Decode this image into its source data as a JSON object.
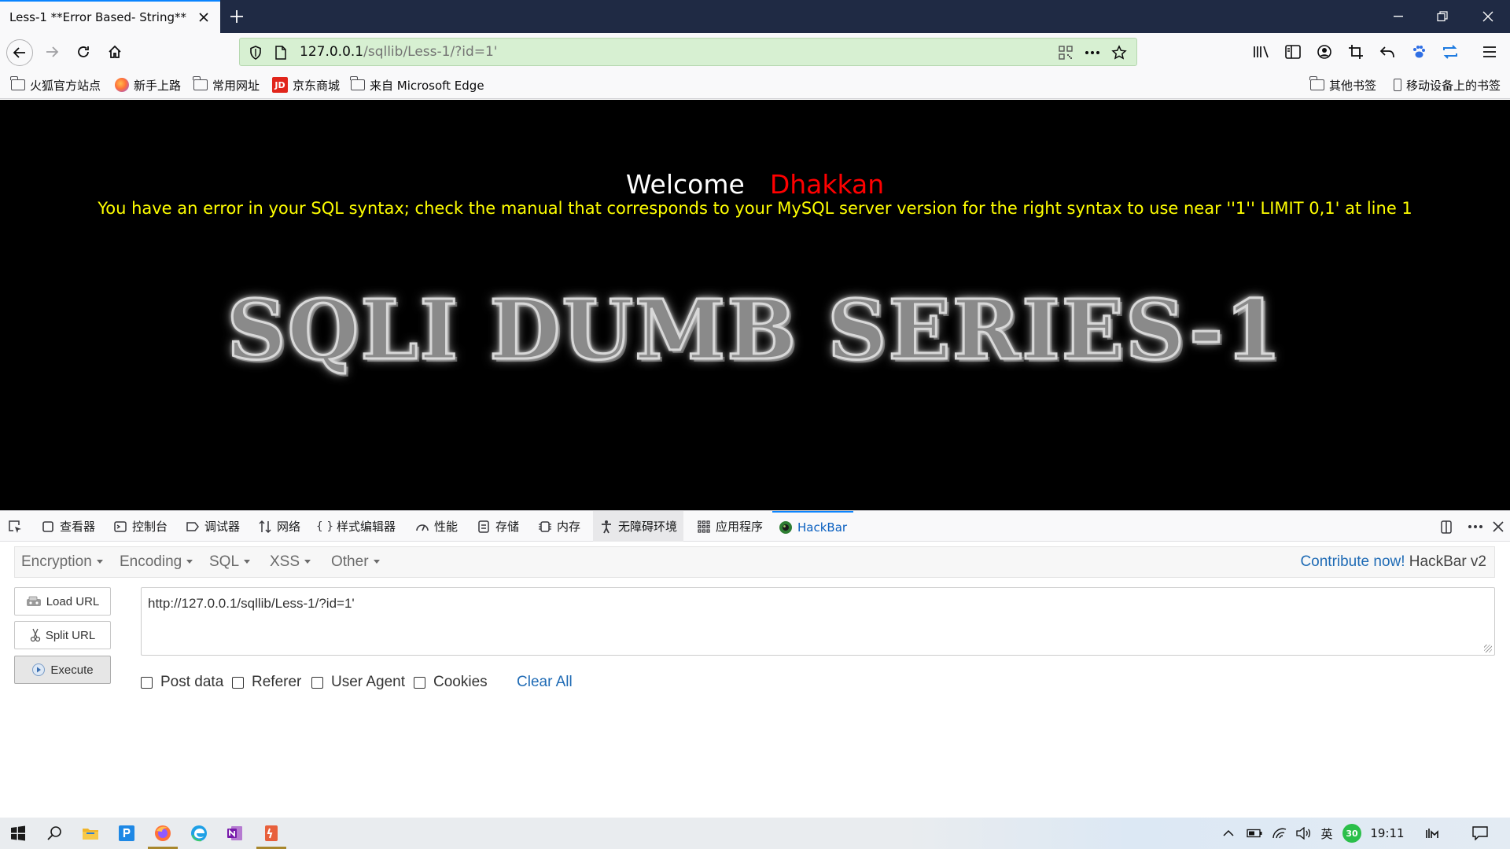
{
  "browser": {
    "tab_title": "Less-1 **Error Based- String**",
    "url_host": "127.0.0.1",
    "url_path": "/sqllib/Less-1/?id=1'"
  },
  "bookmarks": {
    "left": [
      "火狐官方站点",
      "新手上路",
      "常用网址",
      "京东商城",
      "来自 Microsoft Edge"
    ],
    "right": [
      "其他书签",
      "移动设备上的书签"
    ],
    "jd_badge": "JD"
  },
  "page": {
    "welcome": "Welcome",
    "user": "Dhakkan",
    "error": "You have an error in your SQL syntax; check the manual that corresponds to your MySQL server version for the right syntax to use near ''1'' LIMIT 0,1' at line 1",
    "banner": "SQLI DUMB SERIES-1"
  },
  "devtools": {
    "tabs": [
      "查看器",
      "控制台",
      "调试器",
      "网络",
      "样式编辑器",
      "性能",
      "存储",
      "内存",
      "无障碍环境",
      "应用程序",
      "HackBar"
    ],
    "selected_tab": "HackBar"
  },
  "hackbar": {
    "menus": [
      "Encoding",
      "SQL",
      "XSS",
      "Other"
    ],
    "menu_encryption": "Encryption",
    "contribute_link": "Contribute now!",
    "version": "HackBar v2",
    "load_url": "Load URL",
    "split_url": "Split URL",
    "execute": "Execute",
    "url_value": "http://127.0.0.1/sqllib/Less-1/?id=1'",
    "post_data": "Post data",
    "referer": "Referer",
    "user_agent": "User Agent",
    "cookies": "Cookies",
    "clear_all": "Clear All"
  },
  "taskbar": {
    "ime": "英",
    "clock": "19:11",
    "badge": "30"
  },
  "colors": {
    "url_bar": "#d7f0d2",
    "welcome_user": "#ff0000",
    "error_text": "#ffff00",
    "hackbar_link": "#1f6bb5"
  }
}
